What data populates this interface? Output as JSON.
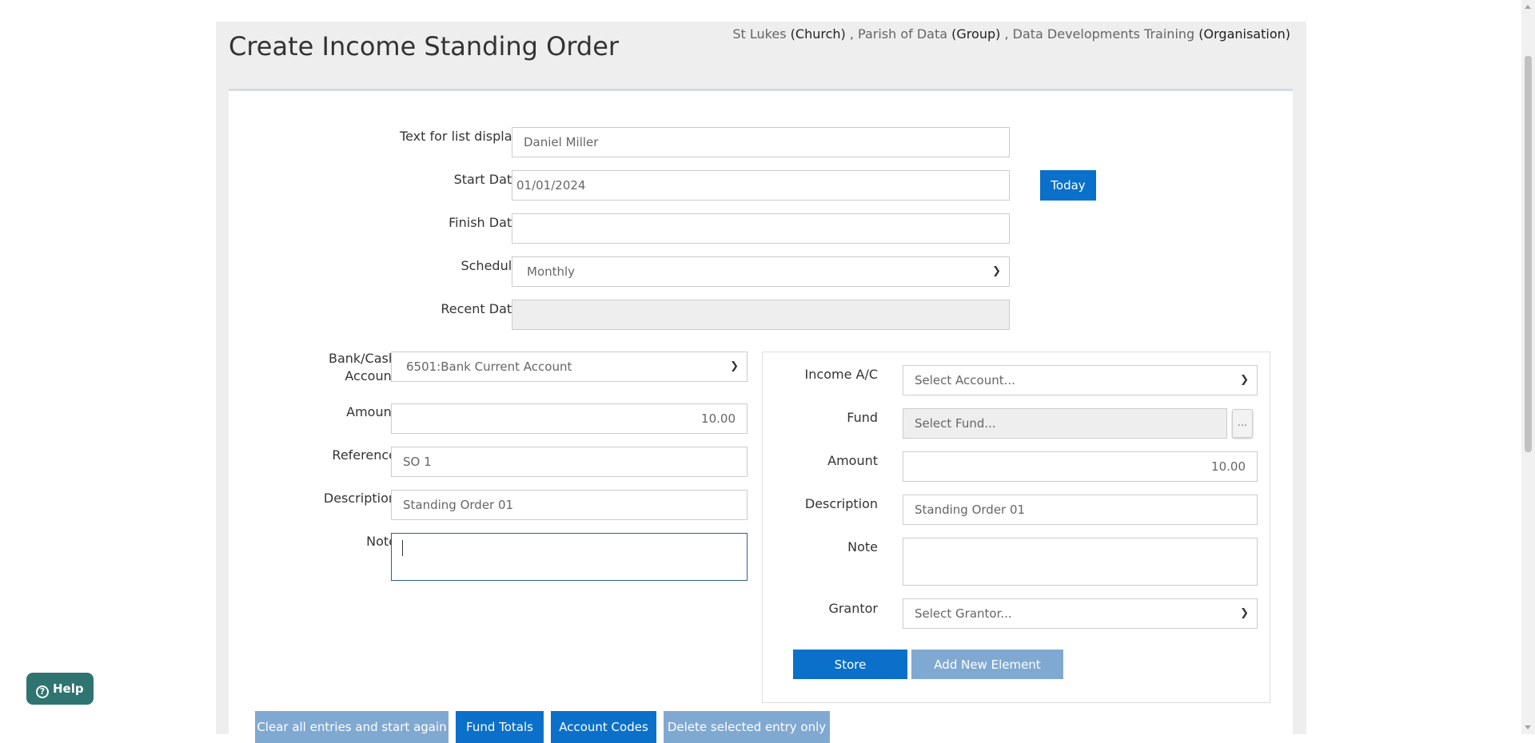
{
  "header": {
    "title": "Create Income Standing Order",
    "breadcrumb": {
      "church_name": "St Lukes",
      "church_kind": "(Church)",
      "group_name": "Parish of Data",
      "group_kind": "(Group)",
      "org_name": "Data Developments Training",
      "org_kind": "(Organisation)",
      "separator": " , "
    }
  },
  "form": {
    "list_display": {
      "label": "Text for list display",
      "value": "Daniel Miller"
    },
    "start_date": {
      "label": "Start Date",
      "value": "01/01/2024"
    },
    "today_button": "Today",
    "finish_date": {
      "label": "Finish Date",
      "value": ""
    },
    "schedule": {
      "label": "Schedule",
      "value": "Monthly"
    },
    "recent_date": {
      "label": "Recent Date",
      "value": ""
    }
  },
  "bank_side": {
    "bank_account": {
      "label_line1": "Bank/Cash",
      "label_line2": "Account",
      "value": "6501:Bank Current Account"
    },
    "amount": {
      "label": "Amount",
      "value": "10.00"
    },
    "reference": {
      "label": "Reference",
      "value": "SO 1"
    },
    "description": {
      "label": "Description",
      "value": "Standing Order 01"
    },
    "note": {
      "label": "Note",
      "value": ""
    }
  },
  "income_side": {
    "income_account": {
      "label": "Income A/C",
      "value": "Select Account..."
    },
    "fund": {
      "label": "Fund",
      "value": "Select Fund...",
      "button": "..."
    },
    "amount": {
      "label": "Amount",
      "value": "10.00"
    },
    "description": {
      "label": "Description",
      "value": "Standing Order 01"
    },
    "note": {
      "label": "Note",
      "value": ""
    },
    "grantor": {
      "label": "Grantor",
      "value": "Select Grantor..."
    },
    "store_button": "Store",
    "add_element_button": "Add New Element"
  },
  "footer_buttons": {
    "clear": "Clear all entries and start again",
    "fund_totals": "Fund Totals",
    "account_codes": "Account Codes",
    "delete_selected": "Delete selected entry only"
  },
  "help": {
    "label": "Help"
  },
  "colors": {
    "primary": "#0a70c9",
    "muted_button": "#80a9d2",
    "help": "#2f7470",
    "page_background": "#efeeee"
  },
  "icons": {
    "select_chevron": "chevron-down-icon",
    "help": "help-circle-icon"
  }
}
